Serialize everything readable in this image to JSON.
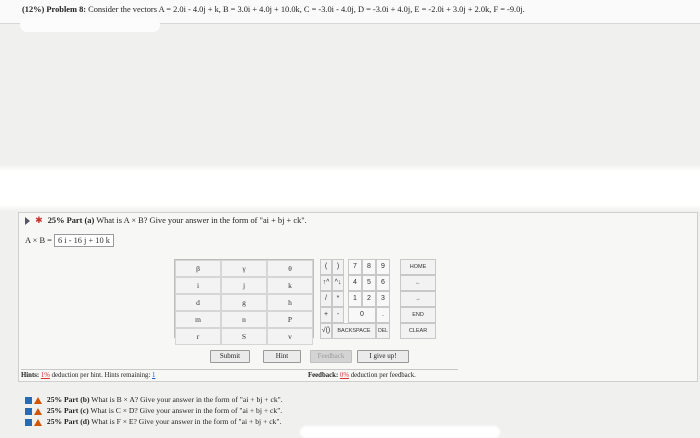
{
  "problem": {
    "prefix": "(12%)",
    "number": "Problem 8:",
    "text": "Consider the vectors A = 2.0i - 4.0j + k, B = 3.0i + 4.0j + 10.0k, C = -3.0i - 4.0j, D = -3.0i + 4.0j, E = -2.0i + 3.0j + 2.0k, F = -9.0j."
  },
  "part_a": {
    "weight": "25%",
    "label": "Part (a)",
    "question": "What is A × B? Give your answer in the form of \"ai + bj + ck\".",
    "answer_label": "A × B =",
    "answer_value": "6 i - 16 j + 10 k"
  },
  "keypad": {
    "rows": [
      [
        "β",
        "γ",
        "θ"
      ],
      [
        "i",
        "j",
        "k"
      ],
      [
        "d",
        "g",
        "h"
      ],
      [
        "m",
        "n",
        "P"
      ],
      [
        "r",
        "S",
        "v"
      ]
    ]
  },
  "calc": {
    "rows": [
      [
        "(",
        ")",
        "",
        "7",
        "8",
        "9"
      ],
      [
        "↑^",
        "^↓",
        "",
        "4",
        "5",
        "6"
      ],
      [
        "/",
        "*",
        "",
        "1",
        "2",
        "3"
      ],
      [
        "+",
        "-",
        "",
        "0",
        ".",
        ""
      ],
      [
        "√()",
        "BACKSPACE",
        "",
        "",
        "DEL",
        ""
      ]
    ],
    "side": [
      "HOME",
      "←",
      "→",
      "END",
      "CLEAR"
    ]
  },
  "buttons": {
    "submit": "Submit",
    "hint": "Hint",
    "feedback": "Feedback",
    "giveup": "I give up!"
  },
  "hints": {
    "label": "Hints:",
    "pct": "1%",
    "text": "deduction per hint. Hints remaining:",
    "remaining": "1"
  },
  "feedback": {
    "label": "Feedback:",
    "pct": "0%",
    "text": "deduction per feedback."
  },
  "parts": [
    {
      "weight": "25%",
      "label": "Part (b)",
      "question": "What is B × A? Give your answer in the form of \"ai + bj + ck\"."
    },
    {
      "weight": "25%",
      "label": "Part (c)",
      "question": "What is C × D? Give your answer in the form of \"ai + bj + ck\"."
    },
    {
      "weight": "25%",
      "label": "Part (d)",
      "question": "What is F × E? Give your answer in the form of \"ai + bj + ck\"."
    }
  ]
}
